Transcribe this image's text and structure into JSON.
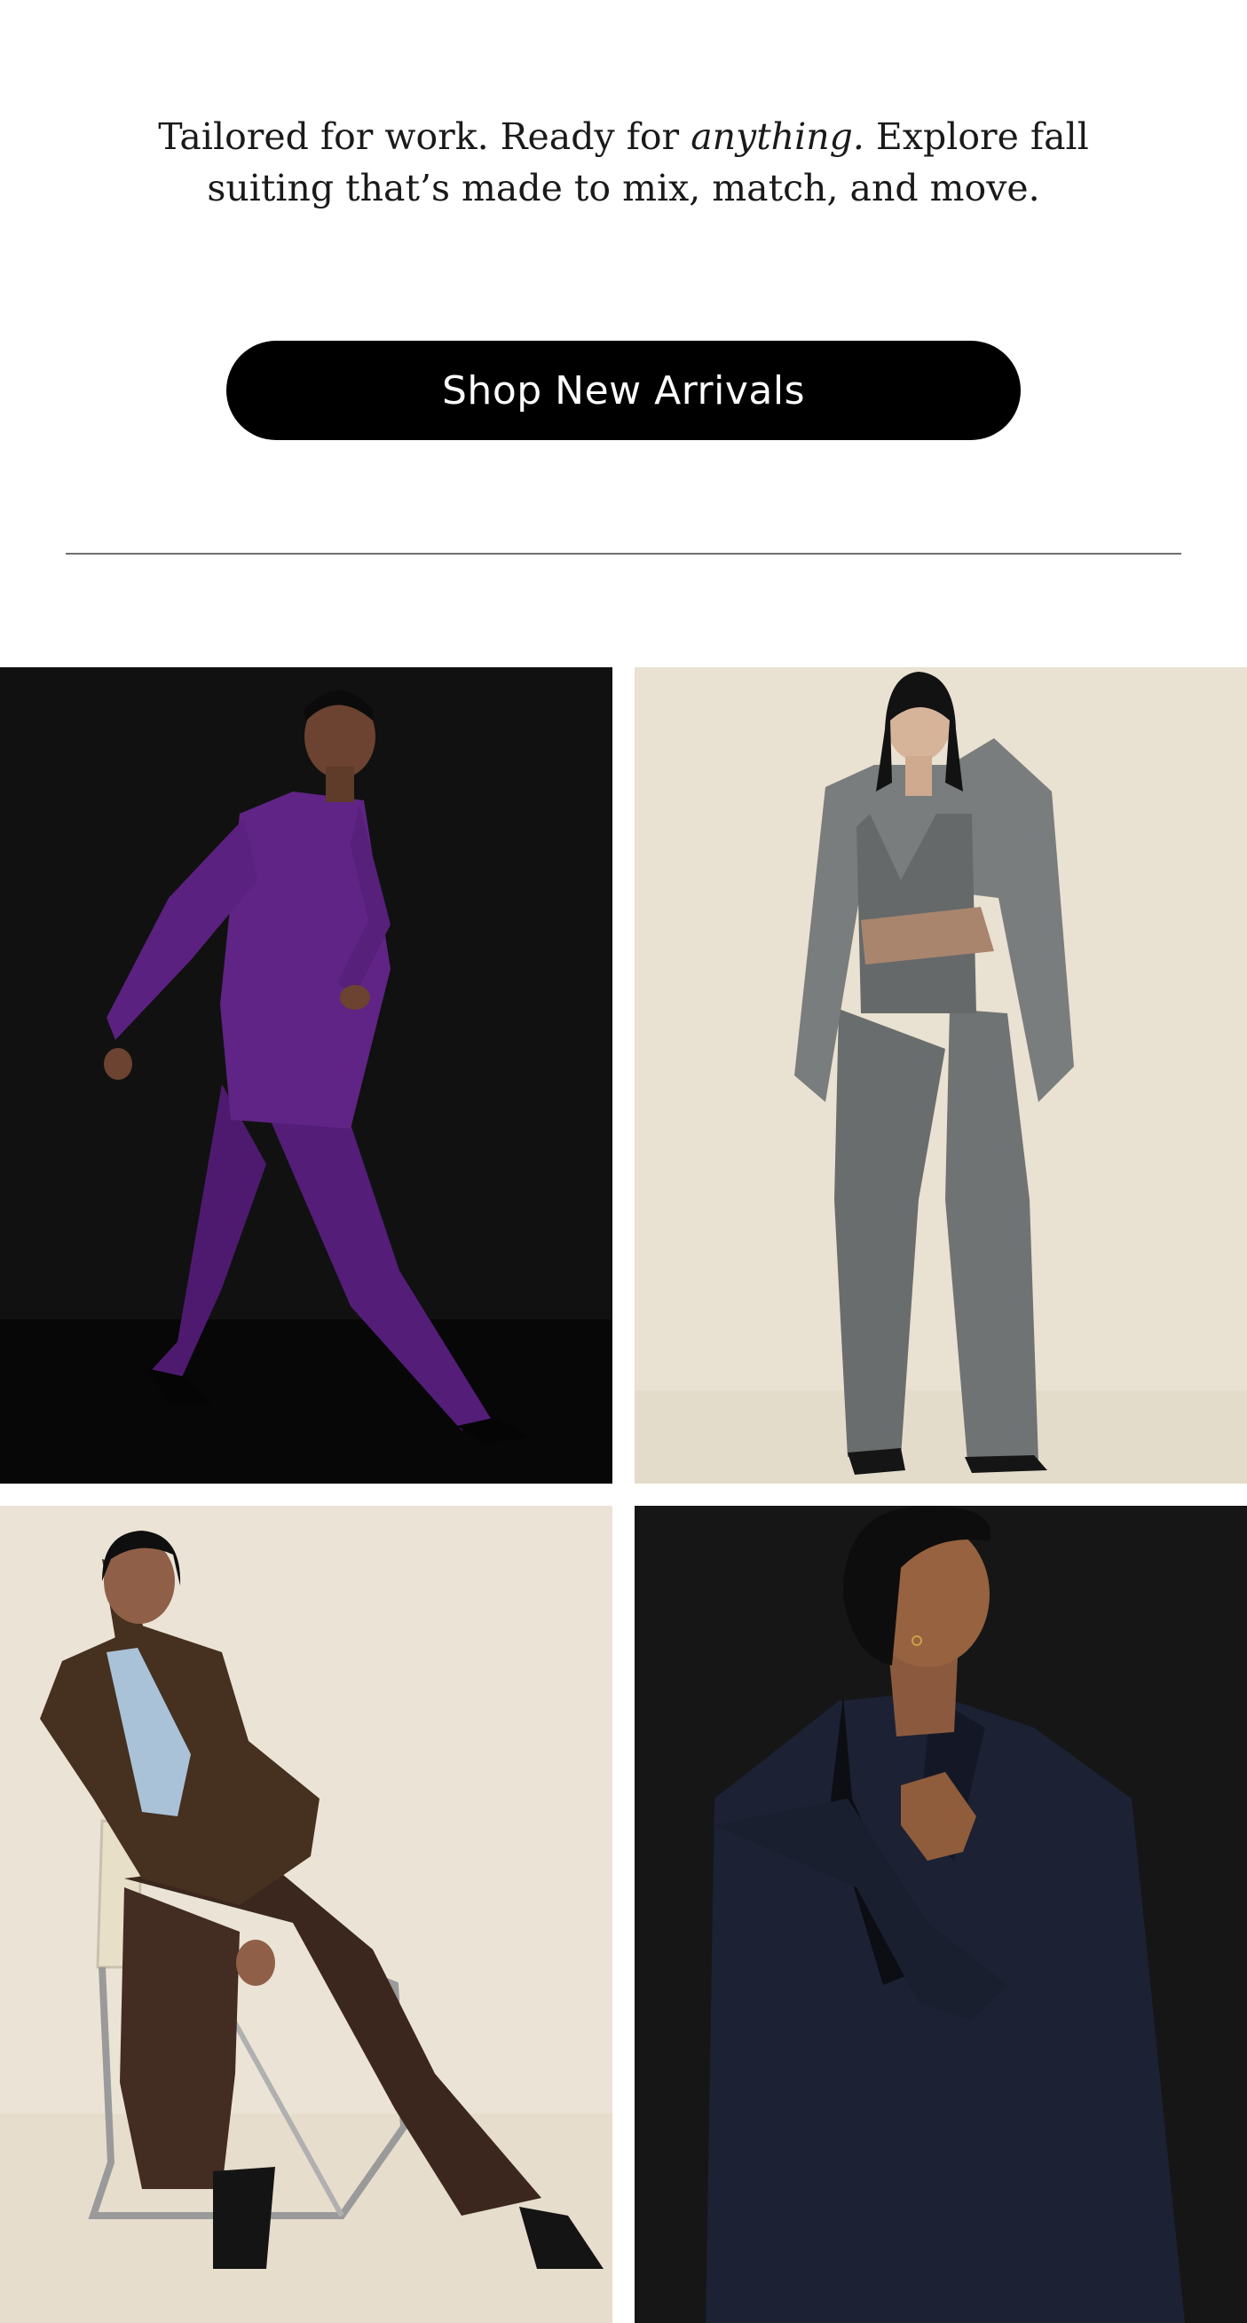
{
  "intro": {
    "before": "Tailored for work. Ready for ",
    "emphasis": "anything.",
    "after": " Explore fall suiting that’s made to mix, match, and move."
  },
  "cta": {
    "label": "Shop New Arrivals"
  },
  "gallery": {
    "tiles": [
      {
        "subject": "purple suit, walking pose",
        "background": "#101010",
        "suit_color": "#5d2282"
      },
      {
        "subject": "grey three-piece suit, arms crossed",
        "background": "#e9e1d1",
        "suit_color": "#6c6f6f"
      },
      {
        "subject": "brown suit with light blue shirt, seated on chair",
        "background": "#ebe4d6",
        "suit_color": "#3f2a20"
      },
      {
        "subject": "navy tuxedo jacket, profile portrait",
        "background": "#151515",
        "suit_color": "#1b2033"
      }
    ]
  }
}
